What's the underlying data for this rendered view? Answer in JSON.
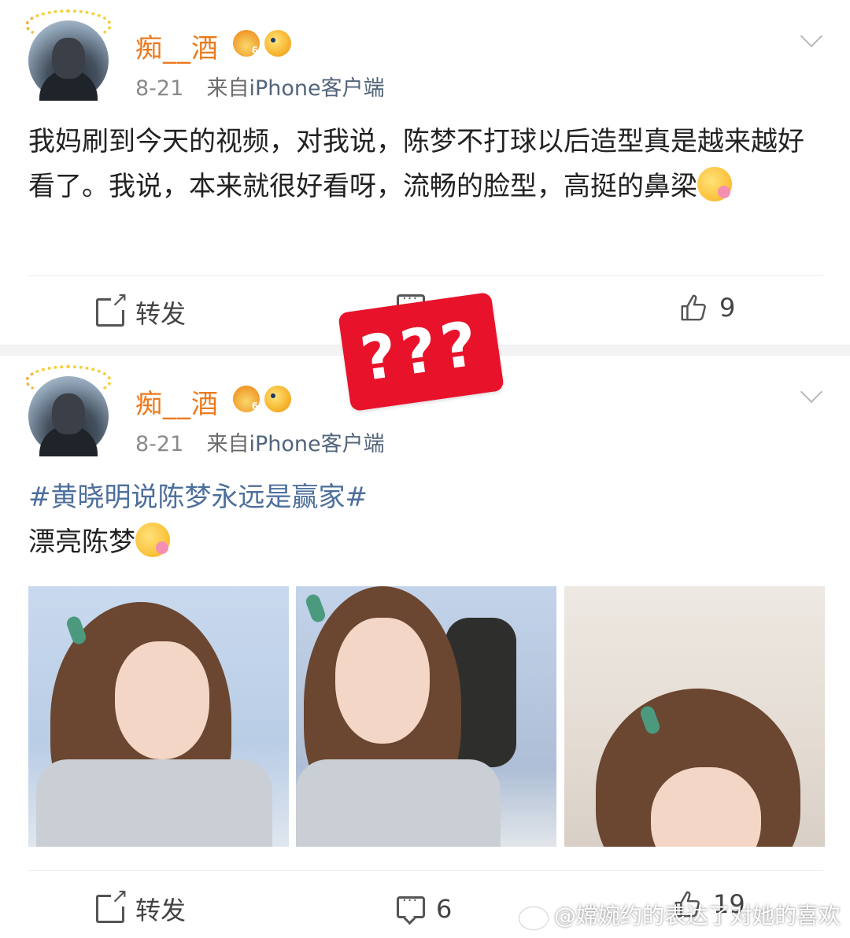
{
  "posts": [
    {
      "user": {
        "name": "痴__酒",
        "avatar": "avatar-girl-photo",
        "badges": [
          "crown-badge",
          "fish-badge"
        ]
      },
      "meta": {
        "date": "8-21",
        "source_prefix": "来自",
        "client": "iPhone客户端"
      },
      "text": "我妈刷到今天的视频，对我说，陈梦不打球以后造型真是越来越好看了。我说，本来就很好看呀，流畅的脸型，高挺的鼻梁",
      "actions": {
        "repost_label": "转发",
        "comment_count": "",
        "like_count": "9"
      }
    },
    {
      "user": {
        "name": "痴__酒",
        "avatar": "avatar-girl-photo",
        "badges": [
          "crown-badge",
          "fish-badge"
        ]
      },
      "meta": {
        "date": "8-21",
        "source_prefix": "来自",
        "client": "iPhone客户端"
      },
      "hashtag": "#黄晓明说陈梦永远是赢家#",
      "text": "漂亮陈梦",
      "photos": [
        "photo-1",
        "photo-2",
        "photo-3"
      ],
      "actions": {
        "repost_label": "转发",
        "comment_count": "6",
        "like_count": "19"
      }
    }
  ],
  "sticker": {
    "text": "???",
    "color": "#e8122a"
  },
  "watermark": {
    "text": "@嫦婉约的表达了对她的喜欢"
  },
  "colors": {
    "username": "#ec7a1d",
    "hashtag": "#4d6f9c",
    "meta": "#8a8a8a"
  }
}
